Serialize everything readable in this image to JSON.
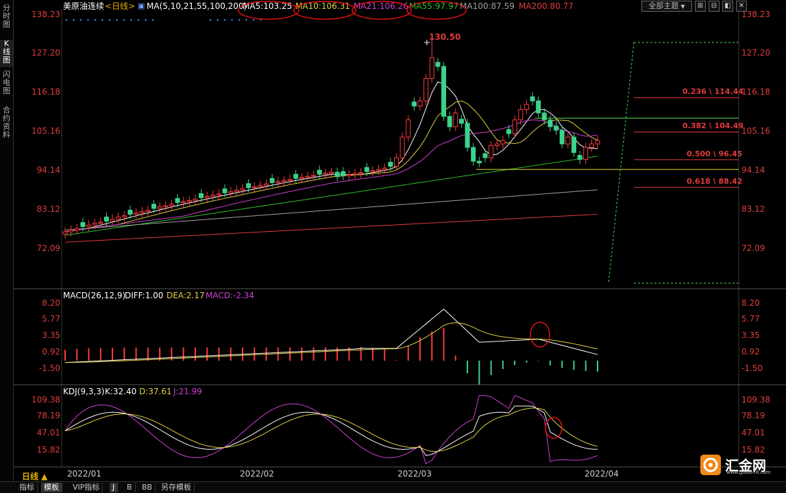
{
  "sidebar": {
    "tabs": [
      {
        "label": "分时图",
        "active": false
      },
      {
        "label": "K线图",
        "active": true
      },
      {
        "label": "闪电图",
        "active": false
      },
      {
        "label": "合约资料",
        "active": false
      }
    ]
  },
  "header": {
    "symbol": "美原油连续",
    "period_tag": "<日线>",
    "ma_params": "MA(5,10,21,55,100,200)",
    "ma": [
      {
        "label": "MA5:103.25",
        "color": "#ffffff"
      },
      {
        "label": "MA10:106.31",
        "color": "#e0d040"
      },
      {
        "label": "MA21:106.26",
        "color": "#d040d0"
      },
      {
        "label": "MA55:97.97",
        "color": "#30c030"
      },
      {
        "label": "MA100:87.59",
        "color": "#a0a0a0"
      },
      {
        "label": "MA200:80.77",
        "color": "#e03c3c"
      }
    ],
    "theme_button": "全部主题",
    "window_buttons": [
      "⊞",
      "⊟",
      "◧",
      "✕"
    ]
  },
  "price_axis": [
    "138.23",
    "127.20",
    "116.18",
    "105.16",
    "94.14",
    "83.12",
    "72.09"
  ],
  "peak_label": "130.50",
  "fib_levels": [
    {
      "label": "0.236 \\ 114.44",
      "price": 114.44
    },
    {
      "label": "0.382 \\ 104.49",
      "price": 104.49
    },
    {
      "label": "0.500 \\ 96.45",
      "price": 96.45
    },
    {
      "label": "0.618 \\ 88.42",
      "price": 88.42
    }
  ],
  "macd": {
    "title": "MACD(26,12,9)",
    "diff": "DIFF:1.00",
    "dea": "DEA:2.17",
    "macd": "MACD:-2.34",
    "axis": [
      "8.20",
      "5.77",
      "3.35",
      "0.92",
      "-1.50"
    ]
  },
  "kdj": {
    "title": "KDJ(9,3,3)",
    "k": "K:32.40",
    "d": "D:37.61",
    "j": "J:21.99",
    "axis": [
      "109.38",
      "78.19",
      "47.01",
      "15.82"
    ]
  },
  "dates": [
    "2022/01",
    "2022/02",
    "2022/03",
    "2022/04"
  ],
  "period": "日线 ▲",
  "bottom_tabs": [
    {
      "label": "指标",
      "active": false
    },
    {
      "label": "模板",
      "active": true
    },
    {
      "label": "VIP指标",
      "active": false
    },
    {
      "label": "J",
      "active": true
    },
    {
      "label": "B",
      "active": false
    },
    {
      "label": "BB",
      "active": false
    },
    {
      "label": "另存模板",
      "active": false
    }
  ],
  "logo": {
    "text": "汇金网",
    "url": "www.gold678.com",
    "color": "#f08a1c"
  },
  "chart_data": {
    "type": "candlestick",
    "price_range": [
      60,
      140
    ],
    "closes": [
      75.5,
      76.0,
      76.5,
      77.0,
      77.5,
      78.0,
      78.3,
      78.6,
      79.2,
      79.8,
      80.2,
      80.6,
      81.0,
      81.4,
      81.8,
      82.3,
      82.8,
      83.1,
      83.5,
      84.0,
      84.3,
      84.6,
      85.0,
      85.4,
      85.8,
      86.2,
      86.5,
      86.8,
      87.2,
      87.6,
      88.0,
      88.3,
      88.6,
      89.0,
      89.4,
      89.8,
      90.1,
      90.4,
      90.7,
      91.0,
      91.3,
      91.6,
      91.9,
      92.2,
      92.5,
      92.8,
      91.5,
      91.8,
      92.1,
      92.4,
      92.7,
      93.0,
      93.3,
      93.6,
      94.0,
      94.5,
      97.0,
      103.0,
      108.0,
      112.0,
      113.5,
      120.0,
      126.0,
      123.5,
      109.0,
      106.0,
      110.0,
      107.0,
      100.0,
      96.0,
      95.5,
      97.0,
      100.5,
      101.0,
      102.0,
      104.0,
      108.0,
      111.0,
      112.5,
      113.5,
      110.0,
      108.0,
      106.0,
      105.0,
      101.0,
      103.0,
      98.5,
      96.5,
      100.0,
      101.0,
      102.0
    ],
    "peak": 130.5,
    "fib_prices": [
      114.44,
      104.49,
      96.45,
      88.42
    ],
    "ma_values": {
      "MA5": 103.25,
      "MA10": 106.31,
      "MA21": 106.26,
      "MA55": 97.97,
      "MA100": 87.59,
      "MA200": 80.77
    },
    "macd_range": [
      -3.8,
      9.5
    ],
    "macd_latest": {
      "diff": 1.0,
      "dea": 2.17,
      "macd": -2.34
    },
    "kdj_range": [
      0,
      115
    ],
    "kdj_latest": {
      "k": 32.4,
      "d": 37.61,
      "j": 21.99
    }
  }
}
